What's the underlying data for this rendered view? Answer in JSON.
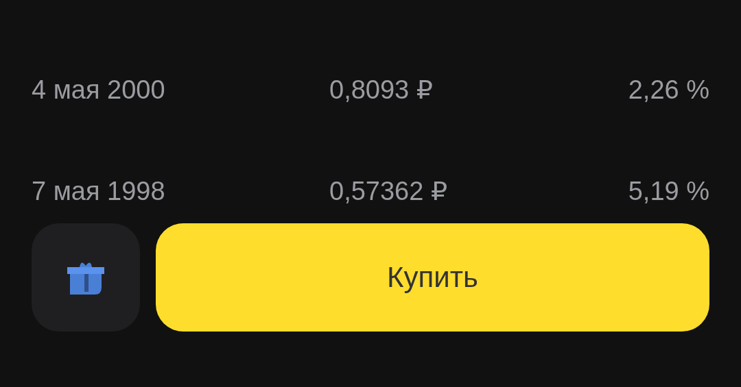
{
  "rows": [
    {
      "date": "4 мая 2000",
      "price": "0,8093 ₽",
      "percent": "2,26 %"
    },
    {
      "date": "7 мая 1998",
      "price": "0,57362 ₽",
      "percent": "5,19 %"
    }
  ],
  "buy_button": {
    "label": "Купить"
  }
}
